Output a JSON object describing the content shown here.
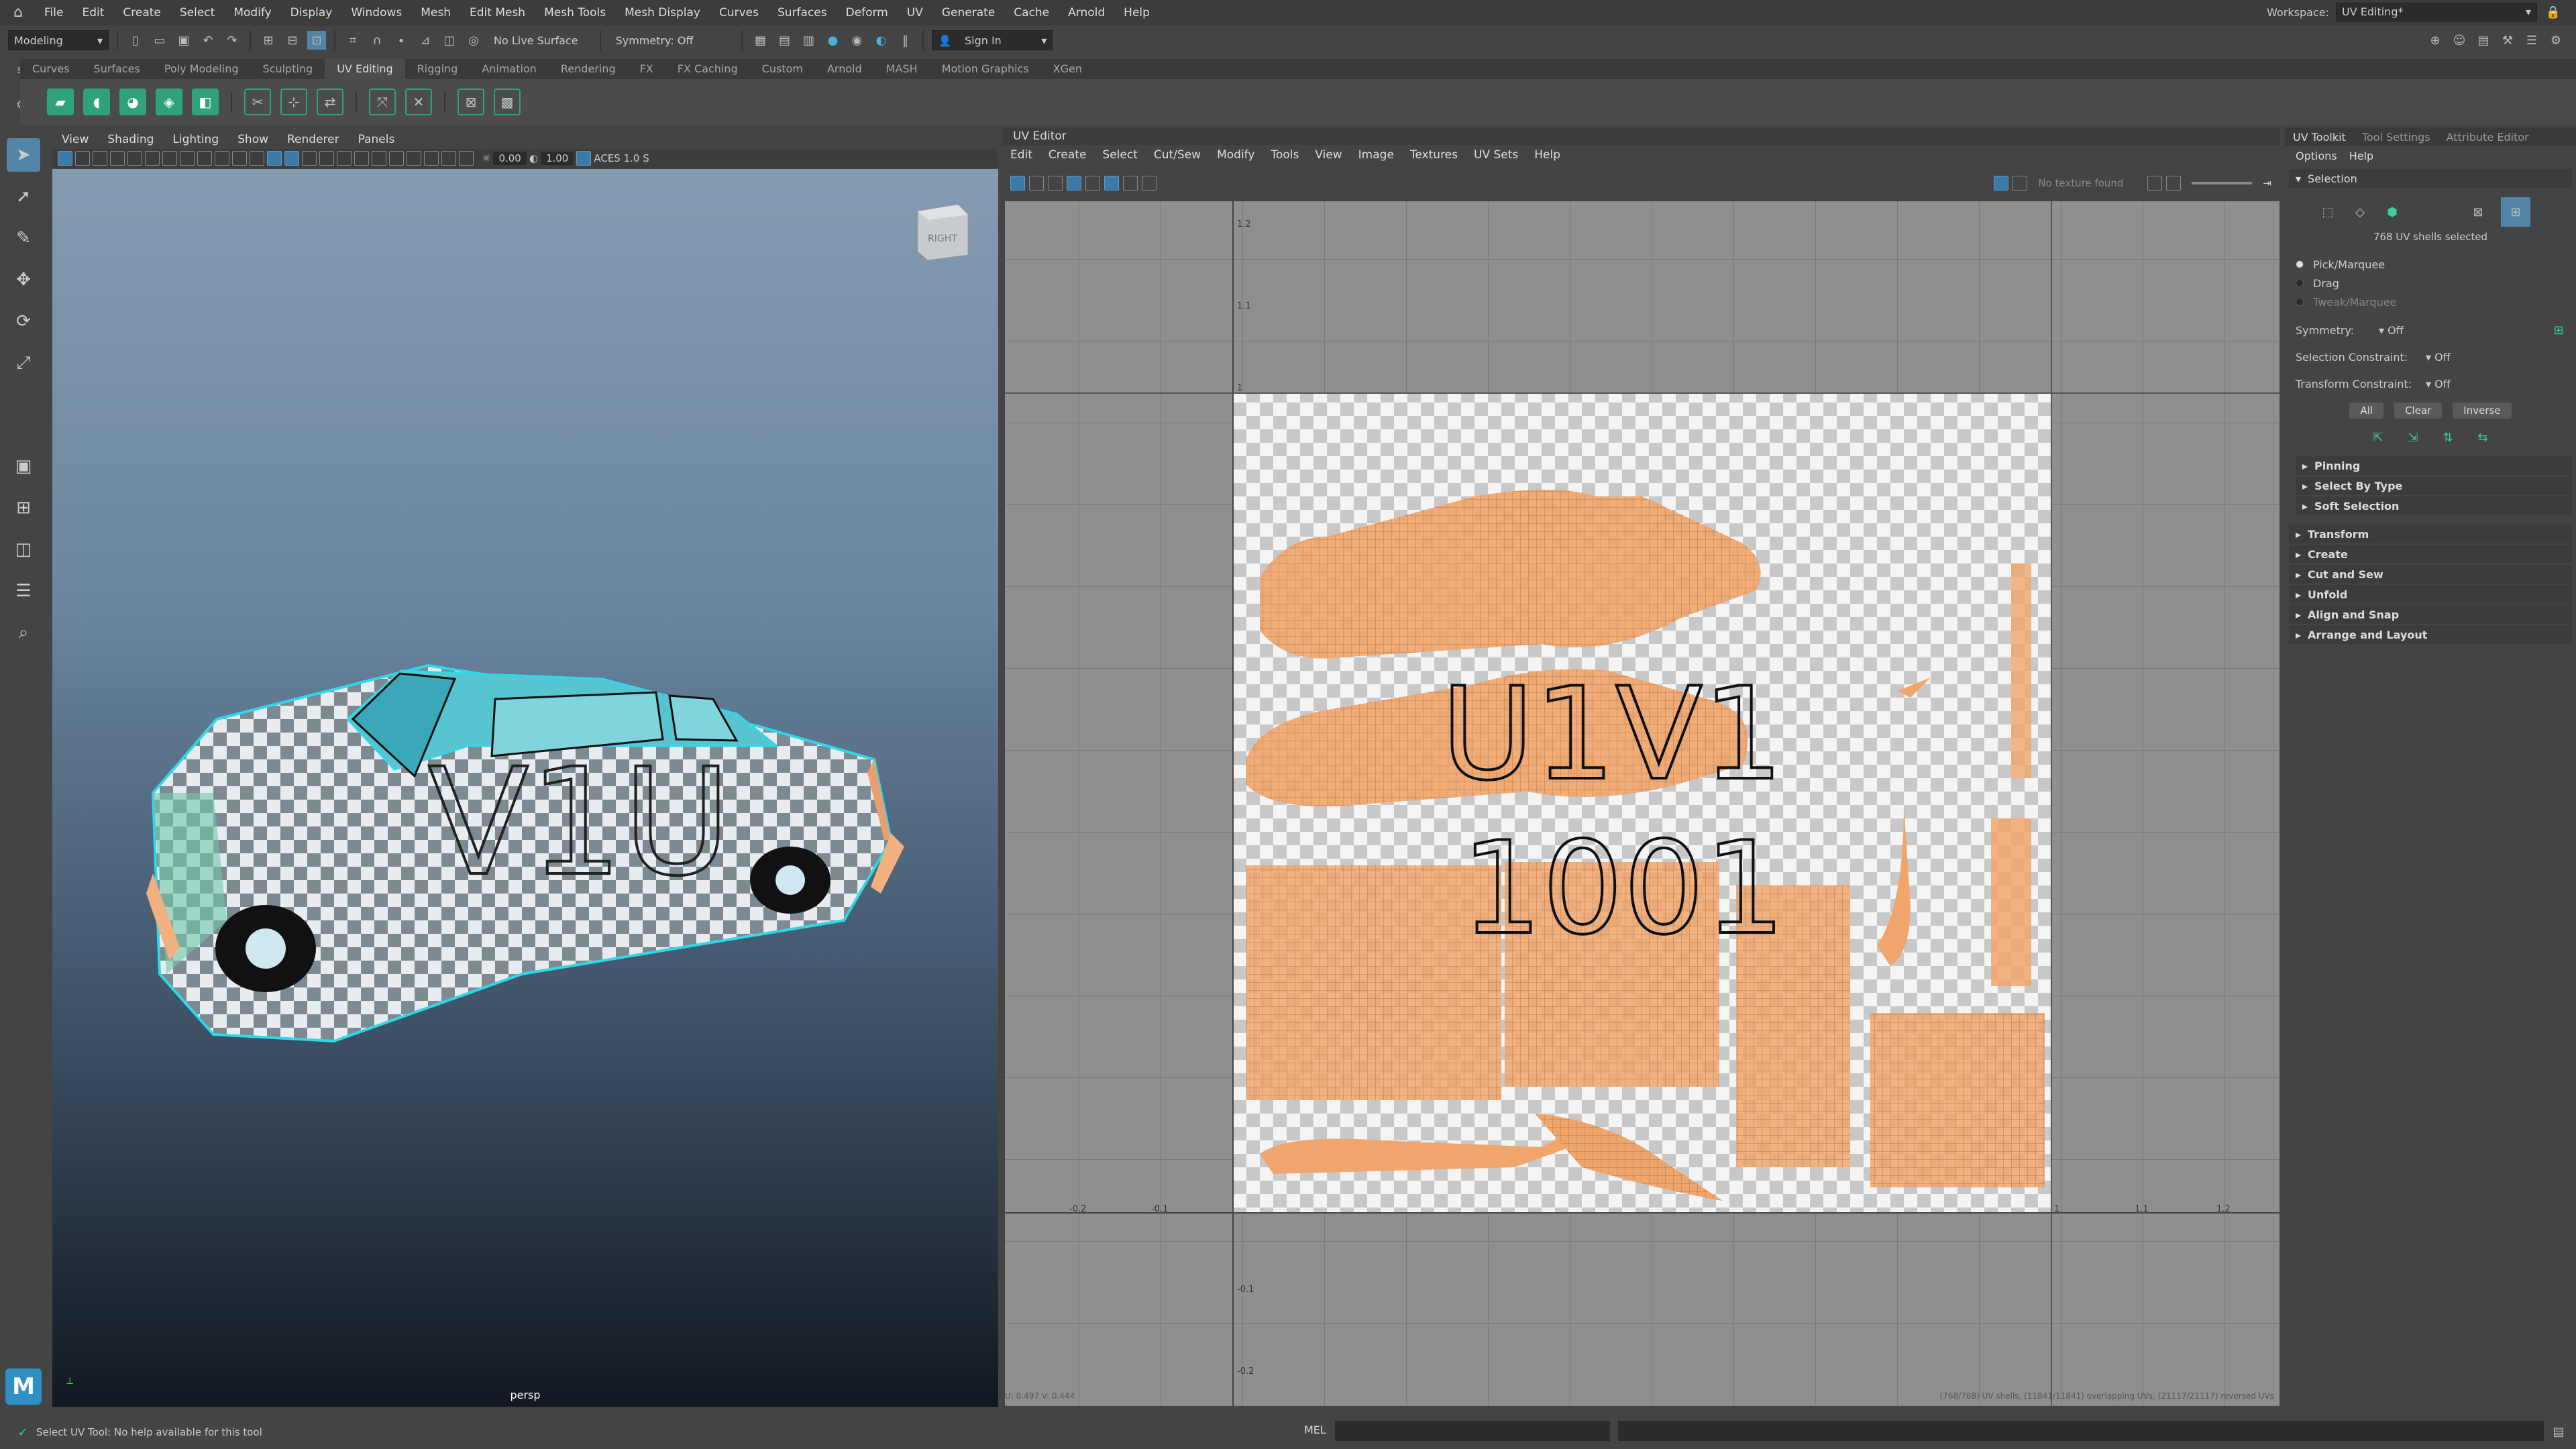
{
  "menubar": {
    "items": [
      "File",
      "Edit",
      "Create",
      "Select",
      "Modify",
      "Display",
      "Windows",
      "Mesh",
      "Edit Mesh",
      "Mesh Tools",
      "Mesh Display",
      "Curves",
      "Surfaces",
      "Deform",
      "UV",
      "Generate",
      "Cache",
      "Arnold",
      "Help"
    ],
    "workspace_label": "Workspace:",
    "workspace_value": "UV Editing*"
  },
  "statusline": {
    "mode": "Modeling",
    "live_surface": "No Live Surface",
    "symmetry": "Symmetry: Off",
    "sign_in": "Sign In"
  },
  "shelf": {
    "tabs": [
      "Curves",
      "Surfaces",
      "Poly Modeling",
      "Sculpting",
      "UV Editing",
      "Rigging",
      "Animation",
      "Rendering",
      "FX",
      "FX Caching",
      "Custom",
      "Arnold",
      "MASH",
      "Motion Graphics",
      "XGen"
    ],
    "active_tab": "UV Editing"
  },
  "viewport": {
    "menus": [
      "View",
      "Shading",
      "Lighting",
      "Show",
      "Renderer",
      "Panels"
    ],
    "value_a": "0.00",
    "value_b": "1.00",
    "colorspace": "ACES 1.0 S",
    "camera_label": "persp",
    "viewcube_label": "RIGHT",
    "car_decal": "V1U"
  },
  "uv_editor": {
    "title": "UV Editor",
    "menus": [
      "Edit",
      "Create",
      "Select",
      "Cut/Sew",
      "Modify",
      "Tools",
      "View",
      "Image",
      "Textures",
      "UV Sets",
      "Help"
    ],
    "texture_status": "No texture found",
    "tile_label_top": "U1V1",
    "tile_label_bottom": "1001",
    "v_ticks": [
      "1.2",
      "1.1",
      "1",
      "-0.1",
      "-0.2"
    ],
    "u_ticks": [
      "-0.2",
      "-0.1",
      "1",
      "1.1",
      "1.2"
    ],
    "coord_readout": "U: 0.497  V: 0.444",
    "stats": "(768/768) UV shells, (11841/11841) overlapping UVs, (21117/21117) reversed UVs"
  },
  "right_panel": {
    "tabs": [
      "UV Toolkit",
      "Tool Settings",
      "Attribute Editor"
    ],
    "menus": [
      "Options",
      "Help"
    ],
    "selection_header": "Selection",
    "shells_selected": "768 UV shells selected",
    "modes": [
      "Pick/Marquee",
      "Drag",
      "Tweak/Marquee"
    ],
    "symmetry_label": "Symmetry:",
    "symmetry_value": "Off",
    "sel_constraint_label": "Selection Constraint:",
    "sel_constraint_value": "Off",
    "xf_constraint_label": "Transform Constraint:",
    "xf_constraint_value": "Off",
    "btn_all": "All",
    "btn_clear": "Clear",
    "btn_inverse": "Inverse",
    "sub_sections": [
      "Pinning",
      "Select By Type",
      "Soft Selection"
    ],
    "sections": [
      "Transform",
      "Create",
      "Cut and Sew",
      "Unfold",
      "Align and Snap",
      "Arrange and Layout"
    ]
  },
  "helpline": {
    "message": "Select UV Tool: No help available for this tool",
    "mel_label": "MEL"
  },
  "colors": {
    "accent_green": "#2fcf9a",
    "uv_shell": "#f0a56c",
    "selection_blue": "#5285a6"
  }
}
